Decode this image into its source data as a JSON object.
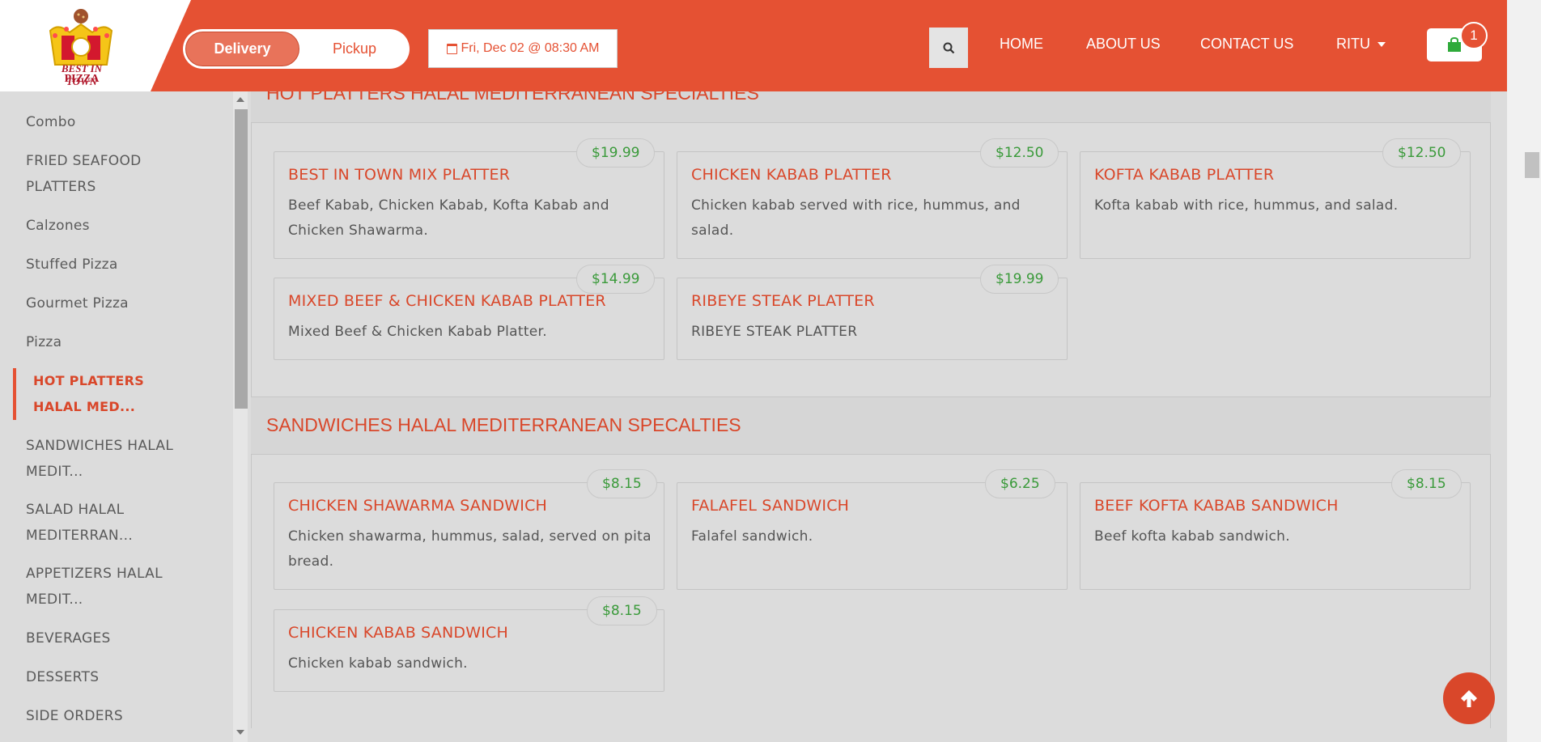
{
  "header": {
    "logo_line1": "BEST IN TOWN",
    "logo_line2": "PIZZA",
    "delivery_label": "Delivery",
    "pickup_label": "Pickup",
    "date_label": "Fri, Dec 02 @ 08:30 AM",
    "nav": [
      "HOME",
      "ABOUT US",
      "CONTACT US"
    ],
    "user_label": "RITU",
    "cart_count": "1",
    "accent_color": "#e55133"
  },
  "sidebar": {
    "items": [
      {
        "label": "Combo"
      },
      {
        "label": "FRIED SEAFOOD PLATTERS"
      },
      {
        "label": "Calzones"
      },
      {
        "label": "Stuffed Pizza"
      },
      {
        "label": "Gourmet Pizza"
      },
      {
        "label": "Pizza"
      },
      {
        "label": "HOT PLATTERS HALAL MED...",
        "active": true
      },
      {
        "label": "SANDWICHES HALAL MEDIT..."
      },
      {
        "label": "SALAD HALAL MEDITERRAN..."
      },
      {
        "label": "APPETIZERS HALAL MEDIT..."
      },
      {
        "label": "BEVERAGES"
      },
      {
        "label": "DESSERTS"
      },
      {
        "label": "SIDE ORDERS"
      }
    ]
  },
  "sections": [
    {
      "title": "HOT PLATTERS HALAL MEDITERRANEAN SPECIALTIES",
      "items": [
        {
          "name": "BEST IN TOWN MIX PLATTER",
          "desc": "Beef Kabab, Chicken Kabab, Kofta Kabab and Chicken Shawarma.",
          "price": "$19.99"
        },
        {
          "name": "CHICKEN KABAB PLATTER",
          "desc": "Chicken kabab served with rice, hummus, and salad.",
          "price": "$12.50"
        },
        {
          "name": "KOFTA KABAB PLATTER",
          "desc": "Kofta kabab with rice, hummus, and salad.",
          "price": "$12.50"
        },
        {
          "name": "MIXED BEEF & CHICKEN KABAB PLATTER",
          "desc": "Mixed Beef & Chicken Kabab Platter.",
          "price": "$14.99"
        },
        {
          "name": "RIBEYE STEAK PLATTER",
          "desc": "RIBEYE STEAK PLATTER",
          "price": "$19.99"
        }
      ]
    },
    {
      "title": "SANDWICHES HALAL MEDITERRANEAN SPECALTIES",
      "items": [
        {
          "name": "CHICKEN SHAWARMA SANDWICH",
          "desc": "Chicken shawarma, hummus, salad, served on pita bread.",
          "price": "$8.15"
        },
        {
          "name": "FALAFEL SANDWICH",
          "desc": "Falafel sandwich.",
          "price": "$6.25"
        },
        {
          "name": "BEEF KOFTA KABAB SANDWICH",
          "desc": "Beef kofta kabab sandwich.",
          "price": "$8.15"
        },
        {
          "name": "CHICKEN KABAB SANDWICH",
          "desc": "Chicken kabab sandwich.",
          "price": "$8.15"
        }
      ]
    }
  ]
}
